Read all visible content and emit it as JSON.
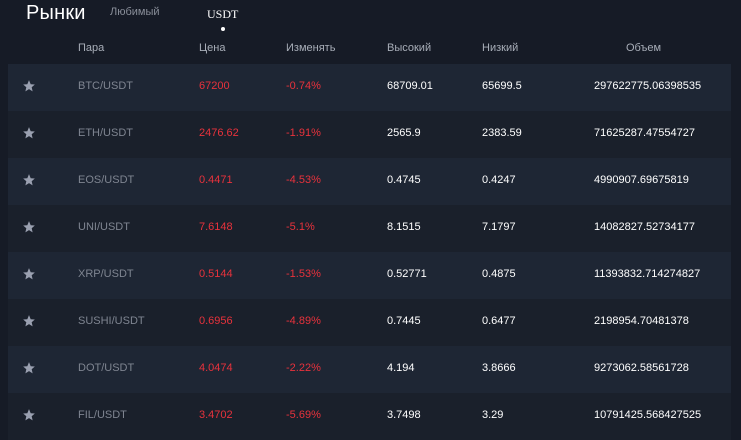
{
  "app": {
    "title": "Рынки"
  },
  "tabs": [
    {
      "label": "Любимый",
      "active": false
    },
    {
      "label": "USDT",
      "active": true
    }
  ],
  "columns": [
    "Пара",
    "Цена",
    "Изменять",
    "Высокий",
    "Низкий",
    "Объем"
  ],
  "colors": {
    "negative": "#e8323c",
    "star": "#9aa0b0",
    "row_odd": "#1e2634",
    "row_even": "#1a202b"
  },
  "rows": [
    {
      "pair": "BTC/USDT",
      "price": "67200",
      "change": "-0.74%",
      "high": "68709.01",
      "low": "65699.5",
      "volume": "297622775.06398535"
    },
    {
      "pair": "ETH/USDT",
      "price": "2476.62",
      "change": "-1.91%",
      "high": "2565.9",
      "low": "2383.59",
      "volume": "71625287.47554727"
    },
    {
      "pair": "EOS/USDT",
      "price": "0.4471",
      "change": "-4.53%",
      "high": "0.4745",
      "low": "0.4247",
      "volume": "4990907.69675819"
    },
    {
      "pair": "UNI/USDT",
      "price": "7.6148",
      "change": "-5.1%",
      "high": "8.1515",
      "low": "7.1797",
      "volume": "14082827.52734177"
    },
    {
      "pair": "XRP/USDT",
      "price": "0.5144",
      "change": "-1.53%",
      "high": "0.52771",
      "low": "0.4875",
      "volume": "11393832.714274827"
    },
    {
      "pair": "SUSHI/USDT",
      "price": "0.6956",
      "change": "-4.89%",
      "high": "0.7445",
      "low": "0.6477",
      "volume": "2198954.70481378"
    },
    {
      "pair": "DOT/USDT",
      "price": "4.0474",
      "change": "-2.22%",
      "high": "4.194",
      "low": "3.8666",
      "volume": "9273062.58561728"
    },
    {
      "pair": "FIL/USDT",
      "price": "3.4702",
      "change": "-5.69%",
      "high": "3.7498",
      "low": "3.29",
      "volume": "10791425.568427525"
    }
  ]
}
